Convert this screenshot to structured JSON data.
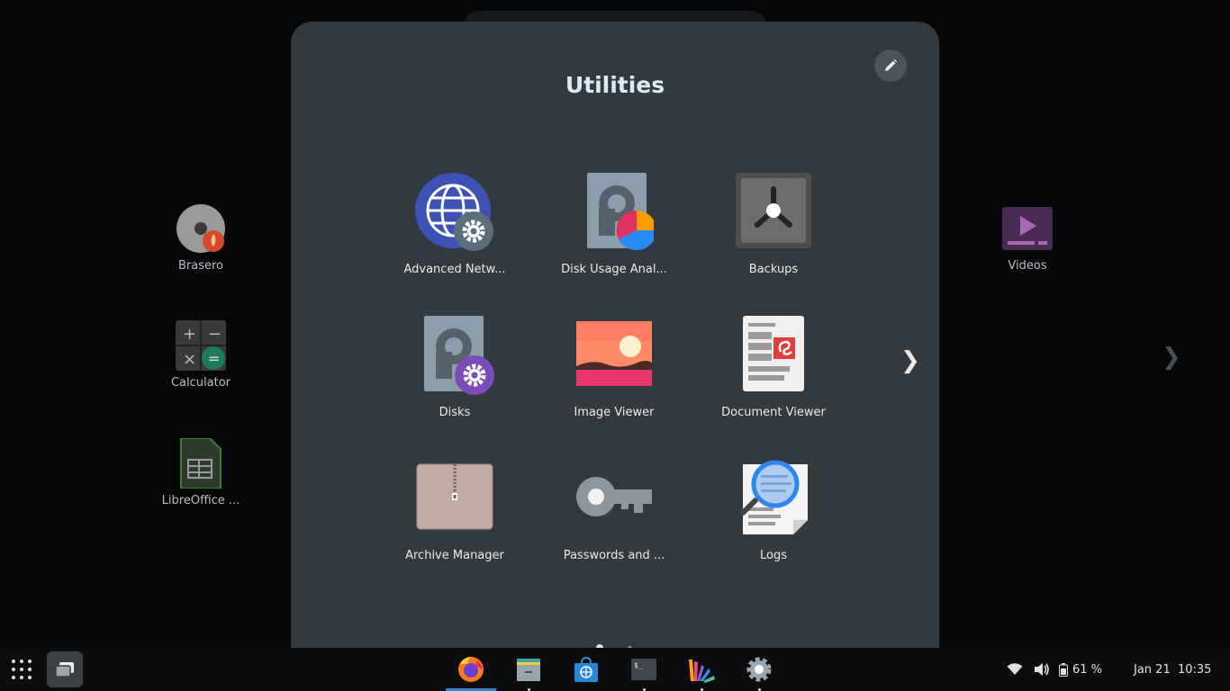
{
  "folder": {
    "title": "Utilities",
    "apps": [
      {
        "label": "Advanced Netw...",
        "icon": "network-settings-icon"
      },
      {
        "label": "Disk Usage Anal...",
        "icon": "disk-usage-icon"
      },
      {
        "label": "Backups",
        "icon": "backups-icon"
      },
      {
        "label": "Disks",
        "icon": "disks-icon"
      },
      {
        "label": "Image Viewer",
        "icon": "image-viewer-icon"
      },
      {
        "label": "Document Viewer",
        "icon": "document-viewer-icon"
      },
      {
        "label": "Archive Manager",
        "icon": "archive-manager-icon"
      },
      {
        "label": "Passwords and ...",
        "icon": "passwords-keys-icon"
      },
      {
        "label": "Logs",
        "icon": "logs-icon"
      }
    ],
    "next_page": "❯"
  },
  "background_apps": [
    {
      "label": "Brasero"
    },
    {
      "label": "Calculator"
    },
    {
      "label": "LibreOffice ..."
    },
    {
      "label": "Videos"
    }
  ],
  "background_next": "❯",
  "taskbar": {
    "battery_label": "61 %",
    "clock": "Jan 21  10:35"
  },
  "colors": {
    "panel": "#363d44",
    "title": "#d8ecf8",
    "active_indicator": "#2f87d8"
  }
}
